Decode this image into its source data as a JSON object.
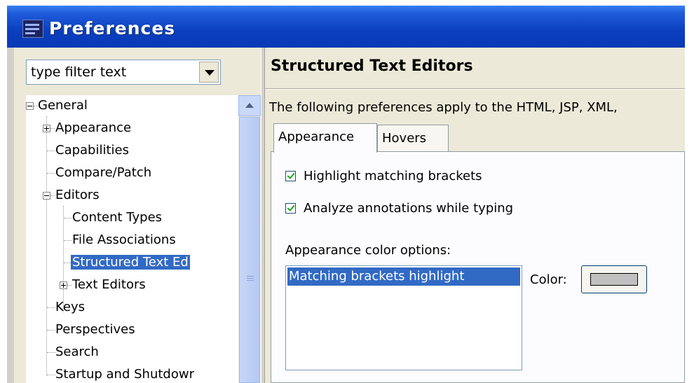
{
  "window": {
    "title": "Preferences"
  },
  "filter": {
    "placeholder": "type filter text"
  },
  "tree": {
    "general": "General",
    "appearance": "Appearance",
    "capabilities": "Capabilities",
    "compare": "Compare/Patch",
    "editors": "Editors",
    "content_types": "Content Types",
    "file_assoc": "File Associations",
    "structured": "Structured Text Ed",
    "text_editors": "Text Editors",
    "keys": "Keys",
    "perspectives": "Perspectives",
    "search": "Search",
    "startup": "Startup and Shutdowr"
  },
  "page": {
    "title": "Structured Text Editors",
    "description": "The following preferences apply to the HTML, JSP, XML,",
    "tabs": [
      "Appearance",
      "Hovers"
    ],
    "checkboxes": [
      {
        "label": "Highlight matching brackets",
        "checked": true
      },
      {
        "label": "Analyze annotations while typing",
        "checked": true
      }
    ],
    "color_options_label": "Appearance color options:",
    "color_list": [
      "Matching brackets highlight"
    ],
    "color_label": "Color:",
    "swatch_color": "#c0c0c0"
  }
}
